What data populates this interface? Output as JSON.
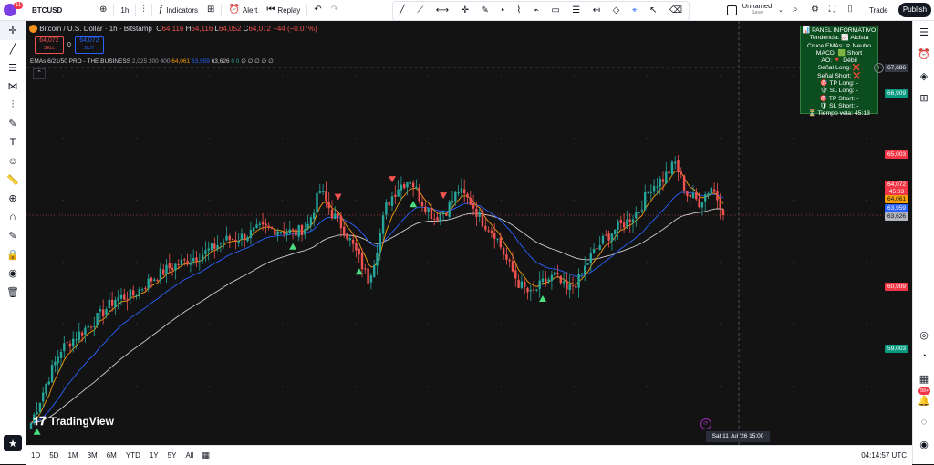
{
  "header": {
    "notification_count": "11",
    "symbol": "BTCUSD",
    "interval": "1h",
    "indicators_label": "Indicators",
    "alert_label": "Alert",
    "replay_label": "Replay",
    "layout_name": "Unnamed",
    "layout_status": "Save",
    "trade_label": "Trade",
    "publish_label": "Publish"
  },
  "legend": {
    "title": "Bitcoin / U.S. Dollar · 1h · Bitstamp",
    "o_label": "O",
    "o_value": "64,116",
    "h_label": "H",
    "h_value": "64,116",
    "l_label": "L",
    "l_value": "64,052",
    "c_label": "C",
    "c_value": "64,072",
    "change": "−44 (−0.07%)",
    "sell_price": "64,072",
    "sell_label": "SELL",
    "spread": "0",
    "buy_price": "64,072",
    "buy_label": "BUY"
  },
  "indicator": {
    "name": "EMAs 6/21/50 PRO - THE BUSINESS",
    "params": "2,025 200 400",
    "v1": "64,061",
    "v2": "63,959",
    "v3": "63,626",
    "zeros": "0 0",
    "empties": "∅ ∅ ∅ ∅ ∅"
  },
  "panel": {
    "title": "📊 PANEL INFORMATIVO",
    "rows": [
      "Tendencia: 📈 Alcista",
      "Cruce EMAs: ⚪ Neutro",
      "MACD: 🟩 Short",
      "AO: 🔻 Débil",
      "Señal Long: ❌",
      "Señal Short: ❌",
      "🎯 TP Long: -",
      "🛡 SL Long: -",
      "🎯 TP Short: -",
      "🛡 SL Short: -",
      "⏳ Tiempo vela: 45:13"
    ]
  },
  "watermark": "TradingView",
  "crosshair_time": "Sat 11 Jul '26   15:00",
  "price_axis": {
    "crosshair_price": "67,686",
    "l66909": "66,909",
    "l65003": "65,003",
    "last_price": "64,072",
    "countdown": "45:03",
    "ema_fast": "64,061",
    "ema_mid": "63,959",
    "ema_slow": "63,626",
    "l60909": "60,909",
    "l59003": "59,003"
  },
  "ranges": [
    "1D",
    "5D",
    "1M",
    "3M",
    "6M",
    "YTD",
    "1Y",
    "5Y",
    "All"
  ],
  "clock": "04:14:57 UTC",
  "right_badge": "99+",
  "colors": {
    "up": "#26a69a",
    "down": "#ef5350",
    "ema_fast": "#f59e0b",
    "ema_mid": "#2962ff",
    "ema_slow": "#cfcfcf",
    "panel_bg": "#0b4d1e"
  },
  "chart_data": {
    "type": "candlestick",
    "ylim": [
      58500,
      68500
    ],
    "anchors": [
      [
        0,
        58600
      ],
      [
        6,
        59800
      ],
      [
        10,
        60500
      ],
      [
        16,
        60900
      ],
      [
        22,
        61300
      ],
      [
        28,
        61800
      ],
      [
        34,
        61900
      ],
      [
        40,
        62300
      ],
      [
        46,
        62600
      ],
      [
        52,
        62800
      ],
      [
        58,
        63000
      ],
      [
        64,
        63300
      ],
      [
        70,
        63400
      ],
      [
        76,
        63600
      ],
      [
        82,
        63600
      ],
      [
        88,
        63500
      ],
      [
        92,
        63700
      ],
      [
        96,
        64600
      ],
      [
        100,
        64000
      ],
      [
        104,
        63600
      ],
      [
        108,
        63000
      ],
      [
        112,
        62300
      ],
      [
        114,
        62800
      ],
      [
        118,
        64200
      ],
      [
        122,
        64700
      ],
      [
        126,
        64900
      ],
      [
        130,
        64300
      ],
      [
        134,
        63900
      ],
      [
        138,
        64100
      ],
      [
        142,
        64600
      ],
      [
        146,
        64300
      ],
      [
        150,
        63800
      ],
      [
        154,
        63500
      ],
      [
        158,
        62800
      ],
      [
        162,
        62200
      ],
      [
        166,
        61900
      ],
      [
        170,
        62200
      ],
      [
        174,
        62400
      ],
      [
        178,
        62000
      ],
      [
        182,
        62300
      ],
      [
        186,
        62900
      ],
      [
        190,
        63300
      ],
      [
        194,
        63600
      ],
      [
        198,
        63800
      ],
      [
        202,
        64100
      ],
      [
        206,
        64700
      ],
      [
        210,
        64900
      ],
      [
        214,
        65300
      ],
      [
        218,
        64500
      ],
      [
        222,
        64300
      ],
      [
        226,
        64700
      ],
      [
        230,
        64100
      ]
    ],
    "buy_signals": [
      2,
      87,
      109,
      127,
      170
    ],
    "sell_signals": [
      102,
      120,
      137
    ]
  }
}
